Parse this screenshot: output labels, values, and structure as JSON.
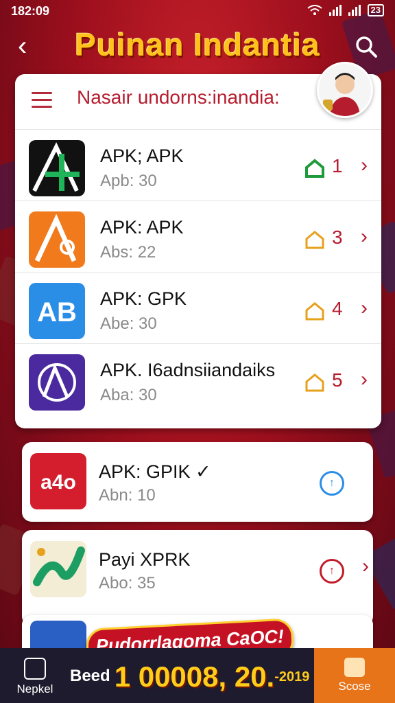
{
  "status": {
    "time": "182:09",
    "battery": "23"
  },
  "header": {
    "title": "Puinan Indantia"
  },
  "panel": {
    "title": "Nasair undorns:inandia:"
  },
  "rows": [
    {
      "name": "APK; APK",
      "sub": "Apb: 30",
      "count": "1",
      "home_color": "#1f9a3b",
      "icon_bg": "#111111",
      "icon_glyph": "A",
      "glyph_color": "#1fb45a"
    },
    {
      "name": "APK: APK",
      "sub": "Abs: 22",
      "count": "3",
      "home_color": "#e6a11d",
      "icon_bg": "#f07a1c",
      "icon_glyph": "A",
      "glyph_color": "#ffffff"
    },
    {
      "name": "APK: GPK",
      "sub": "Abe: 30",
      "count": "4",
      "home_color": "#e6a11d",
      "icon_bg": "#2a8de6",
      "icon_glyph": "AB",
      "glyph_color": "#ffffff"
    },
    {
      "name": "APK. I6adnsiiandaiks",
      "sub": "Aba: 30",
      "count": "5",
      "home_color": "#e6a11d",
      "icon_bg": "#4a2a9e",
      "icon_glyph": "A",
      "glyph_color": "#ffffff"
    }
  ],
  "cards": [
    {
      "name": "APK: GPIK  ✓",
      "sub": "Abn: 10",
      "circle": "↑",
      "circle_color": "#2a8de6",
      "icon_bg": "#d41e2d",
      "icon_glyph": "a4o",
      "glyph_color": "#ffffff"
    },
    {
      "name": "Payi  XPRK",
      "sub": "Abo: 35",
      "circle": "↑",
      "circle_color": "#c21c2a",
      "icon_bg": "#f3edd6",
      "icon_glyph": "N",
      "glyph_color": "#1c9e63"
    }
  ],
  "promo": {
    "text": "Pudorrlagoma CaOC!"
  },
  "counter": {
    "label": "Beed",
    "value": "1 00008, 20.",
    "suffix": "-2019"
  },
  "bottom_nav": {
    "left_label": "Nepkel",
    "right_label": "Scose"
  }
}
